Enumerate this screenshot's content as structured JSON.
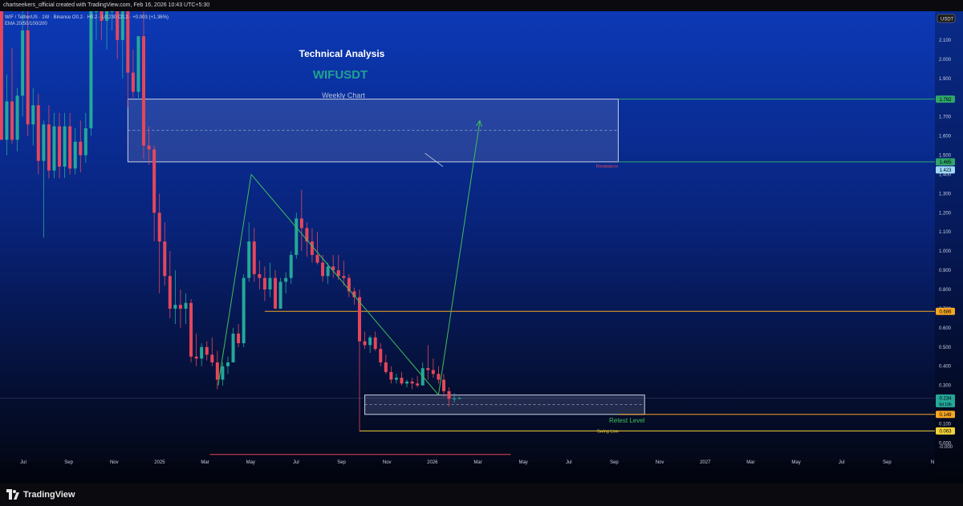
{
  "header": {
    "caption": "chartseekers_official created with TradingView.com, Feb 16, 2026 10:43 UTC+5:30"
  },
  "symbol_info": {
    "line1": "WIF / TetherUS · 1W · Binance  O0.2·· H0.2·· L0.230  C0.2·· +0.003 (+1.36%)",
    "line2": "EMA 20/50/100/200"
  },
  "footer": {
    "brand": "TradingView"
  },
  "colors": {
    "up": "#25a79a",
    "down": "#e5475a",
    "pattern_line": "#3fc05a",
    "resistance_line": "#2ea66a",
    "support_line": "#f5a623",
    "swing_line": "#f2d23b",
    "zone_fill": "rgba(140,150,190,0.22)"
  },
  "chart_data": {
    "type": "candlestick",
    "title": "Technical Analysis",
    "symbol": "WIFUSDT",
    "subtitle": "Weekly Chart",
    "price_axis_label": "USDT",
    "y_ticks": [
      "2.100",
      "2.000",
      "1.900",
      "1.800",
      "1.700",
      "1.600",
      "1.500",
      "1.400",
      "1.300",
      "1.200",
      "1.100",
      "1.000",
      "0.900",
      "0.800",
      "0.700",
      "0.600",
      "0.500",
      "0.400",
      "0.300",
      "0.200",
      "0.100",
      "0.000",
      "-0.000"
    ],
    "ylim": [
      -0.04,
      2.25
    ],
    "x_ticks": [
      "Jul",
      "Sep",
      "Nov",
      "2025",
      "Mar",
      "May",
      "Jul",
      "Sep",
      "Nov",
      "2026",
      "Mar",
      "May",
      "Jul",
      "Sep",
      "Nov",
      "2027",
      "Mar",
      "May",
      "Jul",
      "Sep",
      "N"
    ],
    "x_axis_range": [
      "2024-06-15",
      "2027-11-10"
    ],
    "candles": [
      {
        "date": "2024-06-17",
        "o": 2.37,
        "h": 2.55,
        "l": 1.95,
        "c": 1.58
      },
      {
        "date": "2024-06-24",
        "o": 1.58,
        "h": 1.92,
        "l": 1.5,
        "c": 1.78
      },
      {
        "date": "2024-07-01",
        "o": 1.78,
        "h": 2.06,
        "l": 1.56,
        "c": 1.58
      },
      {
        "date": "2024-07-08",
        "o": 1.58,
        "h": 1.85,
        "l": 1.52,
        "c": 1.81
      },
      {
        "date": "2024-07-15",
        "o": 1.81,
        "h": 2.25,
        "l": 1.7,
        "c": 2.15
      },
      {
        "date": "2024-07-22",
        "o": 2.15,
        "h": 2.25,
        "l": 1.6,
        "c": 1.66
      },
      {
        "date": "2024-07-29",
        "o": 1.66,
        "h": 1.85,
        "l": 1.55,
        "c": 1.76
      },
      {
        "date": "2024-08-05",
        "o": 1.76,
        "h": 1.82,
        "l": 1.4,
        "c": 1.47
      },
      {
        "date": "2024-08-12",
        "o": 1.47,
        "h": 1.68,
        "l": 1.07,
        "c": 1.66
      },
      {
        "date": "2024-08-19",
        "o": 1.66,
        "h": 1.76,
        "l": 1.38,
        "c": 1.42
      },
      {
        "date": "2024-08-26",
        "o": 1.42,
        "h": 1.72,
        "l": 1.38,
        "c": 1.65
      },
      {
        "date": "2024-09-02",
        "o": 1.65,
        "h": 1.72,
        "l": 1.38,
        "c": 1.44
      },
      {
        "date": "2024-09-09",
        "o": 1.44,
        "h": 1.72,
        "l": 1.38,
        "c": 1.65
      },
      {
        "date": "2024-09-16",
        "o": 1.65,
        "h": 1.72,
        "l": 1.4,
        "c": 1.43
      },
      {
        "date": "2024-09-23",
        "o": 1.43,
        "h": 1.64,
        "l": 1.4,
        "c": 1.57
      },
      {
        "date": "2024-09-30",
        "o": 1.57,
        "h": 1.68,
        "l": 1.41,
        "c": 1.5
      },
      {
        "date": "2024-10-07",
        "o": 1.5,
        "h": 1.72,
        "l": 1.46,
        "c": 1.64
      },
      {
        "date": "2024-10-14",
        "o": 1.64,
        "h": 2.25,
        "l": 1.6,
        "c": 2.25
      },
      {
        "date": "2024-10-21",
        "o": 2.25,
        "h": 2.25,
        "l": 2.1,
        "c": 2.25
      },
      {
        "date": "2024-10-28",
        "o": 2.25,
        "h": 2.25,
        "l": 2.1,
        "c": 2.2
      },
      {
        "date": "2024-11-04",
        "o": 2.2,
        "h": 2.25,
        "l": 2.05,
        "c": 2.25
      },
      {
        "date": "2024-11-11",
        "o": 2.25,
        "h": 2.25,
        "l": 2.15,
        "c": 2.25
      },
      {
        "date": "2024-11-18",
        "o": 2.25,
        "h": 2.25,
        "l": 2.0,
        "c": 2.1
      },
      {
        "date": "2024-11-25",
        "o": 2.1,
        "h": 2.25,
        "l": 1.9,
        "c": 2.25
      },
      {
        "date": "2024-12-02",
        "o": 2.25,
        "h": 2.25,
        "l": 1.75,
        "c": 1.93
      },
      {
        "date": "2024-12-09",
        "o": 1.93,
        "h": 2.05,
        "l": 1.8,
        "c": 1.83
      },
      {
        "date": "2024-12-16",
        "o": 1.83,
        "h": 2.05,
        "l": 1.79,
        "c": 2.12
      },
      {
        "date": "2024-12-23",
        "o": 2.12,
        "h": 2.25,
        "l": 1.48,
        "c": 1.55
      },
      {
        "date": "2024-12-30",
        "o": 1.55,
        "h": 1.65,
        "l": 1.45,
        "c": 1.53
      },
      {
        "date": "2025-01-06",
        "o": 1.53,
        "h": 1.55,
        "l": 1.05,
        "c": 1.2
      },
      {
        "date": "2025-01-13",
        "o": 1.2,
        "h": 1.3,
        "l": 0.78,
        "c": 1.05
      },
      {
        "date": "2025-01-20",
        "o": 1.05,
        "h": 1.15,
        "l": 0.82,
        "c": 0.87
      },
      {
        "date": "2025-01-27",
        "o": 0.87,
        "h": 1.0,
        "l": 0.65,
        "c": 0.7
      },
      {
        "date": "2025-02-03",
        "o": 0.7,
        "h": 0.9,
        "l": 0.62,
        "c": 0.72
      },
      {
        "date": "2025-02-10",
        "o": 0.72,
        "h": 0.8,
        "l": 0.6,
        "c": 0.7
      },
      {
        "date": "2025-02-17",
        "o": 0.7,
        "h": 0.78,
        "l": 0.62,
        "c": 0.73
      },
      {
        "date": "2025-02-24",
        "o": 0.73,
        "h": 0.75,
        "l": 0.42,
        "c": 0.45
      },
      {
        "date": "2025-03-03",
        "o": 0.45,
        "h": 0.57,
        "l": 0.4,
        "c": 0.44
      },
      {
        "date": "2025-03-10",
        "o": 0.44,
        "h": 0.52,
        "l": 0.4,
        "c": 0.5
      },
      {
        "date": "2025-03-17",
        "o": 0.5,
        "h": 0.53,
        "l": 0.43,
        "c": 0.46
      },
      {
        "date": "2025-03-24",
        "o": 0.46,
        "h": 0.55,
        "l": 0.4,
        "c": 0.42
      },
      {
        "date": "2025-03-31",
        "o": 0.42,
        "h": 0.48,
        "l": 0.28,
        "c": 0.33
      },
      {
        "date": "2025-04-07",
        "o": 0.33,
        "h": 0.42,
        "l": 0.3,
        "c": 0.4
      },
      {
        "date": "2025-04-14",
        "o": 0.4,
        "h": 0.45,
        "l": 0.36,
        "c": 0.42
      },
      {
        "date": "2025-04-21",
        "o": 0.42,
        "h": 0.6,
        "l": 0.42,
        "c": 0.57
      },
      {
        "date": "2025-04-28",
        "o": 0.57,
        "h": 0.62,
        "l": 0.5,
        "c": 0.52
      },
      {
        "date": "2025-05-05",
        "o": 0.52,
        "h": 0.88,
        "l": 0.5,
        "c": 0.86
      },
      {
        "date": "2025-05-12",
        "o": 0.86,
        "h": 1.15,
        "l": 0.84,
        "c": 1.05
      },
      {
        "date": "2025-05-19",
        "o": 1.05,
        "h": 1.12,
        "l": 0.84,
        "c": 0.88
      },
      {
        "date": "2025-05-26",
        "o": 0.88,
        "h": 0.95,
        "l": 0.8,
        "c": 0.86
      },
      {
        "date": "2025-06-02",
        "o": 0.86,
        "h": 0.92,
        "l": 0.74,
        "c": 0.8
      },
      {
        "date": "2025-06-09",
        "o": 0.8,
        "h": 0.94,
        "l": 0.76,
        "c": 0.86
      },
      {
        "date": "2025-06-16",
        "o": 0.86,
        "h": 0.9,
        "l": 0.7,
        "c": 0.7
      },
      {
        "date": "2025-06-23",
        "o": 0.7,
        "h": 0.86,
        "l": 0.7,
        "c": 0.84
      },
      {
        "date": "2025-06-30",
        "o": 0.84,
        "h": 0.89,
        "l": 0.78,
        "c": 0.86
      },
      {
        "date": "2025-07-07",
        "o": 0.86,
        "h": 1.0,
        "l": 0.83,
        "c": 0.98
      },
      {
        "date": "2025-07-14",
        "o": 0.98,
        "h": 1.2,
        "l": 0.96,
        "c": 1.17
      },
      {
        "date": "2025-07-21",
        "o": 1.17,
        "h": 1.32,
        "l": 1.0,
        "c": 1.12
      },
      {
        "date": "2025-07-28",
        "o": 1.12,
        "h": 1.15,
        "l": 0.97,
        "c": 1.05
      },
      {
        "date": "2025-08-04",
        "o": 1.05,
        "h": 1.12,
        "l": 0.94,
        "c": 0.98
      },
      {
        "date": "2025-08-11",
        "o": 0.98,
        "h": 1.1,
        "l": 0.93,
        "c": 0.94
      },
      {
        "date": "2025-08-18",
        "o": 0.94,
        "h": 0.98,
        "l": 0.84,
        "c": 0.87
      },
      {
        "date": "2025-08-25",
        "o": 0.87,
        "h": 0.94,
        "l": 0.83,
        "c": 0.92
      },
      {
        "date": "2025-09-01",
        "o": 0.92,
        "h": 0.98,
        "l": 0.86,
        "c": 0.9
      },
      {
        "date": "2025-09-08",
        "o": 0.9,
        "h": 0.98,
        "l": 0.85,
        "c": 0.87
      },
      {
        "date": "2025-09-15",
        "o": 0.87,
        "h": 0.95,
        "l": 0.82,
        "c": 0.86
      },
      {
        "date": "2025-09-22",
        "o": 0.86,
        "h": 0.88,
        "l": 0.76,
        "c": 0.79
      },
      {
        "date": "2025-09-29",
        "o": 0.79,
        "h": 0.81,
        "l": 0.72,
        "c": 0.76
      },
      {
        "date": "2025-10-06",
        "o": 0.76,
        "h": 0.8,
        "l": 0.06,
        "c": 0.53
      },
      {
        "date": "2025-10-13",
        "o": 0.53,
        "h": 0.58,
        "l": 0.49,
        "c": 0.51
      },
      {
        "date": "2025-10-20",
        "o": 0.51,
        "h": 0.56,
        "l": 0.47,
        "c": 0.55
      },
      {
        "date": "2025-10-27",
        "o": 0.55,
        "h": 0.58,
        "l": 0.48,
        "c": 0.49
      },
      {
        "date": "2025-11-03",
        "o": 0.49,
        "h": 0.52,
        "l": 0.4,
        "c": 0.42
      },
      {
        "date": "2025-11-10",
        "o": 0.42,
        "h": 0.46,
        "l": 0.36,
        "c": 0.37
      },
      {
        "date": "2025-11-17",
        "o": 0.37,
        "h": 0.4,
        "l": 0.31,
        "c": 0.33
      },
      {
        "date": "2025-11-24",
        "o": 0.33,
        "h": 0.36,
        "l": 0.31,
        "c": 0.34
      },
      {
        "date": "2025-12-01",
        "o": 0.34,
        "h": 0.37,
        "l": 0.3,
        "c": 0.31
      },
      {
        "date": "2025-12-08",
        "o": 0.31,
        "h": 0.33,
        "l": 0.29,
        "c": 0.32
      },
      {
        "date": "2025-12-15",
        "o": 0.32,
        "h": 0.34,
        "l": 0.28,
        "c": 0.31
      },
      {
        "date": "2025-12-22",
        "o": 0.31,
        "h": 0.35,
        "l": 0.29,
        "c": 0.3
      },
      {
        "date": "2025-12-29",
        "o": 0.3,
        "h": 0.42,
        "l": 0.3,
        "c": 0.39
      },
      {
        "date": "2026-01-05",
        "o": 0.39,
        "h": 0.51,
        "l": 0.33,
        "c": 0.38
      },
      {
        "date": "2026-01-12",
        "o": 0.38,
        "h": 0.44,
        "l": 0.34,
        "c": 0.36
      },
      {
        "date": "2026-01-19",
        "o": 0.36,
        "h": 0.4,
        "l": 0.31,
        "c": 0.33
      },
      {
        "date": "2026-01-26",
        "o": 0.33,
        "h": 0.36,
        "l": 0.24,
        "c": 0.27
      },
      {
        "date": "2026-02-02",
        "o": 0.27,
        "h": 0.29,
        "l": 0.19,
        "c": 0.23
      },
      {
        "date": "2026-02-09",
        "o": 0.23,
        "h": 0.26,
        "l": 0.21,
        "c": 0.232
      },
      {
        "date": "2026-02-16",
        "o": 0.232,
        "h": 0.24,
        "l": 0.228,
        "c": 0.234
      }
    ],
    "levels": [
      {
        "name": "resistance-top",
        "price": 1.792,
        "label": "1.792",
        "from": "2026-09-15",
        "color": "#2ea66a"
      },
      {
        "name": "resistance-bottom",
        "price": 1.465,
        "label": "1.465",
        "from": "2026-09-15",
        "color": "#2ea66a"
      },
      {
        "name": "level-0.686",
        "price": 0.686,
        "label": "0.686",
        "from": "2025-06-02",
        "color": "#f5a623"
      },
      {
        "name": "retest-level",
        "price": 0.149,
        "label": "0.149",
        "from": "2026-09-15",
        "color": "#f5a623"
      },
      {
        "name": "swing-low",
        "price": 0.063,
        "label": "0.063",
        "from": "2025-10-06",
        "color": "#f2d23b"
      }
    ],
    "price_labels": [
      {
        "name": "price-1.423",
        "value": 1.423,
        "label": "1.423",
        "color": "#9fd8ff"
      },
      {
        "name": "current-price",
        "value": 0.234,
        "label": "0.234",
        "sublabel": "6d 19h",
        "color": "#25a79a"
      }
    ],
    "zones": [
      {
        "name": "resistance-zone",
        "from": "2024-12-02",
        "to": "2026-09-15",
        "top": 1.792,
        "bottom": 1.465,
        "label": "Resistance"
      },
      {
        "name": "retest-zone",
        "from": "2025-10-13",
        "to": "2026-10-20",
        "top": 0.25,
        "bottom": 0.149,
        "label": "Retest Level"
      }
    ],
    "annotations": {
      "swing_low_label": "Swing Low",
      "pattern_lines": [
        [
          {
            "date": "2025-04-01",
            "p": 0.3
          },
          {
            "date": "2025-05-15",
            "p": 1.4
          }
        ],
        [
          {
            "date": "2025-05-15",
            "p": 1.4
          },
          {
            "date": "2026-01-19",
            "p": 0.25
          }
        ]
      ],
      "projection_arrow": [
        {
          "date": "2026-01-19",
          "p": 0.25
        },
        {
          "date": "2026-03-15",
          "p": 1.68
        }
      ],
      "red_hline": {
        "from": "2025-03-21",
        "to": "2026-04-25",
        "p": -0.06
      }
    }
  }
}
